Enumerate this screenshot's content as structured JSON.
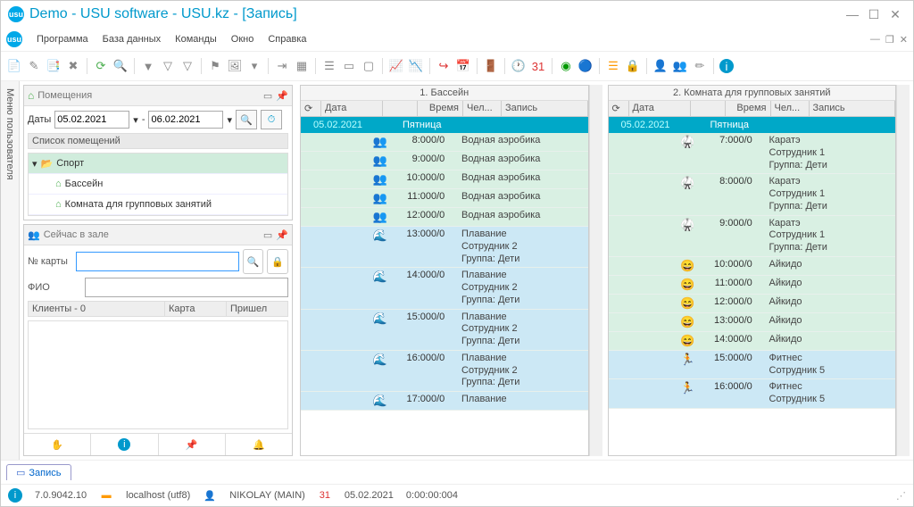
{
  "title": "Demo - USU software - USU.kz - [Запись]",
  "menu": {
    "program": "Программа",
    "db": "База данных",
    "cmd": "Команды",
    "win": "Окно",
    "help": "Справка"
  },
  "rooms_panel": {
    "title": "Помещения",
    "dates_label": "Даты",
    "date_from": "05.02.2021",
    "date_to": "06.02.2021",
    "list_header": "Список помещений",
    "tree": {
      "root": "Спорт",
      "items": [
        "Бассейн",
        "Комната для групповых занятий"
      ]
    }
  },
  "now_panel": {
    "title": "Сейчас в зале",
    "card_label": "№ карты",
    "fio_label": "ФИО",
    "clients_header": "Клиенты - 0",
    "cols": {
      "card": "Карта",
      "came": "Пришел"
    }
  },
  "schedules": [
    {
      "title": "1. Бассейн",
      "cols": {
        "date": "Дата",
        "time": "Время",
        "ppl": "Чел...",
        "rec": "Запись"
      },
      "day": {
        "date": "05.02.2021",
        "name": "Пятница"
      },
      "rows": [
        {
          "cls": "a",
          "ico": "👥",
          "time": "8:00",
          "ppl": "0/0",
          "rec": "Водная аэробика"
        },
        {
          "cls": "a",
          "ico": "👥",
          "time": "9:00",
          "ppl": "0/0",
          "rec": "Водная аэробика"
        },
        {
          "cls": "a",
          "ico": "👥",
          "time": "10:00",
          "ppl": "0/0",
          "rec": "Водная аэробика"
        },
        {
          "cls": "a",
          "ico": "👥",
          "time": "11:00",
          "ppl": "0/0",
          "rec": "Водная аэробика"
        },
        {
          "cls": "a",
          "ico": "👥",
          "time": "12:00",
          "ppl": "0/0",
          "rec": "Водная аэробика"
        },
        {
          "cls": "b",
          "ico": "🌊",
          "time": "13:00",
          "ppl": "0/0",
          "rec": "Плавание\nСотрудник 2\nГруппа: Дети"
        },
        {
          "cls": "b",
          "ico": "🌊",
          "time": "14:00",
          "ppl": "0/0",
          "rec": "Плавание\nСотрудник 2\nГруппа: Дети"
        },
        {
          "cls": "b",
          "ico": "🌊",
          "time": "15:00",
          "ppl": "0/0",
          "rec": "Плавание\nСотрудник 2\nГруппа: Дети"
        },
        {
          "cls": "b",
          "ico": "🌊",
          "time": "16:00",
          "ppl": "0/0",
          "rec": "Плавание\nСотрудник 2\nГруппа: Дети"
        },
        {
          "cls": "b",
          "ico": "🌊",
          "time": "17:00",
          "ppl": "0/0",
          "rec": "Плавание"
        }
      ]
    },
    {
      "title": "2. Комната для групповых занятий",
      "cols": {
        "date": "Дата",
        "time": "Время",
        "ppl": "Чел...",
        "rec": "Запись"
      },
      "day": {
        "date": "05.02.2021",
        "name": "Пятница"
      },
      "rows": [
        {
          "cls": "a",
          "ico": "🥋",
          "time": "7:00",
          "ppl": "0/0",
          "rec": "Каратэ\nСотрудник 1\nГруппа: Дети"
        },
        {
          "cls": "a",
          "ico": "🥋",
          "time": "8:00",
          "ppl": "0/0",
          "rec": "Каратэ\nСотрудник 1\nГруппа: Дети"
        },
        {
          "cls": "a",
          "ico": "🥋",
          "time": "9:00",
          "ppl": "0/0",
          "rec": "Каратэ\nСотрудник 1\nГруппа: Дети"
        },
        {
          "cls": "a",
          "ico": "😄",
          "time": "10:00",
          "ppl": "0/0",
          "rec": "Айкидо"
        },
        {
          "cls": "a",
          "ico": "😄",
          "time": "11:00",
          "ppl": "0/0",
          "rec": "Айкидо"
        },
        {
          "cls": "a",
          "ico": "😄",
          "time": "12:00",
          "ppl": "0/0",
          "rec": "Айкидо"
        },
        {
          "cls": "a",
          "ico": "😄",
          "time": "13:00",
          "ppl": "0/0",
          "rec": "Айкидо"
        },
        {
          "cls": "a",
          "ico": "😄",
          "time": "14:00",
          "ppl": "0/0",
          "rec": "Айкидо"
        },
        {
          "cls": "b",
          "ico": "🏃",
          "time": "15:00",
          "ppl": "0/0",
          "rec": "Фитнес\nСотрудник 5"
        },
        {
          "cls": "b",
          "ico": "🏃",
          "time": "16:00",
          "ppl": "0/0",
          "rec": "Фитнес\nСотрудник 5"
        }
      ]
    }
  ],
  "tab": "Запись",
  "status": {
    "ver": "7.0.9042.10",
    "host": "localhost (utf8)",
    "user": "NIKOLAY (MAIN)",
    "date": "05.02.2021",
    "time": "0:00:00:004"
  }
}
